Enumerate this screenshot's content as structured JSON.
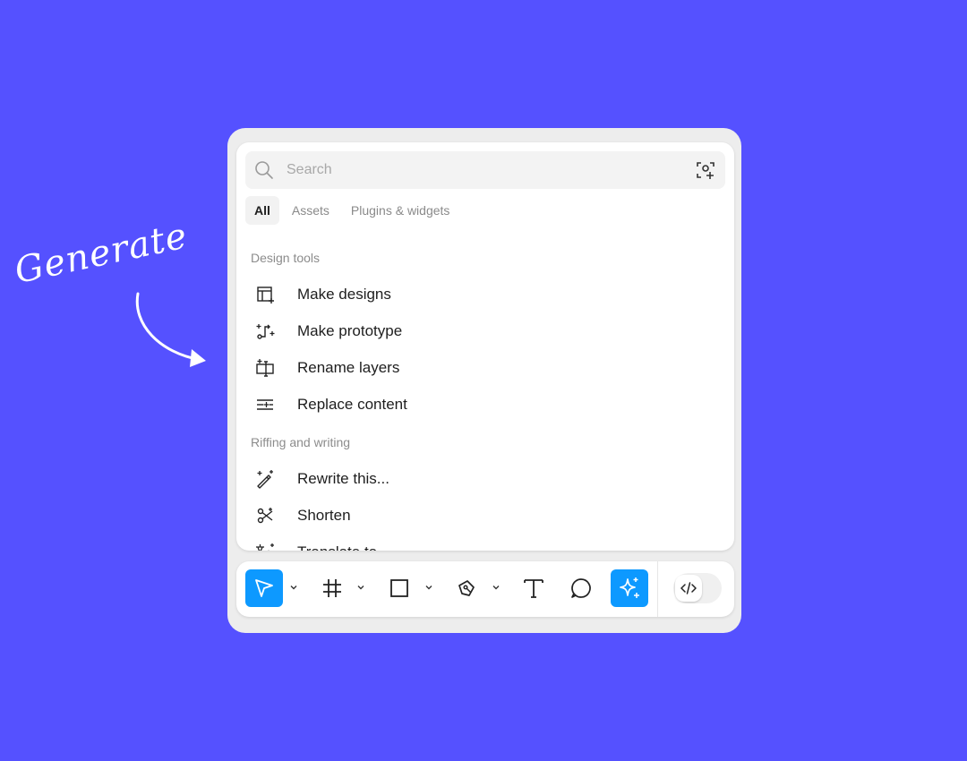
{
  "annotation": {
    "text": "Generate"
  },
  "search": {
    "placeholder": "Search",
    "icon": "search-icon",
    "action_icon": "ai-scan-icon"
  },
  "tabs": [
    {
      "label": "All",
      "active": true
    },
    {
      "label": "Assets",
      "active": false
    },
    {
      "label": "Plugins & widgets",
      "active": false
    }
  ],
  "sections": [
    {
      "title": "Design tools",
      "items": [
        {
          "label": "Make designs",
          "icon": "make-designs-icon"
        },
        {
          "label": "Make prototype",
          "icon": "make-prototype-icon"
        },
        {
          "label": "Rename layers",
          "icon": "rename-layers-icon"
        },
        {
          "label": "Replace content",
          "icon": "replace-content-icon"
        }
      ]
    },
    {
      "title": "Riffing and writing",
      "items": [
        {
          "label": "Rewrite this...",
          "icon": "rewrite-icon"
        },
        {
          "label": "Shorten",
          "icon": "shorten-icon"
        },
        {
          "label": "Translate to...",
          "icon": "translate-icon"
        }
      ]
    }
  ],
  "toolbar": {
    "tools": [
      "move-tool",
      "frame-tool",
      "rectangle-tool",
      "pen-tool",
      "text-tool",
      "comment-tool",
      "actions-tool"
    ],
    "active_tools": [
      "move-tool",
      "actions-tool"
    ],
    "dev_mode_icon": "code-icon"
  },
  "colors": {
    "background": "#5551FF",
    "accent": "#0D99FF",
    "panel": "#FFFFFF",
    "frame": "#EDEDED"
  }
}
